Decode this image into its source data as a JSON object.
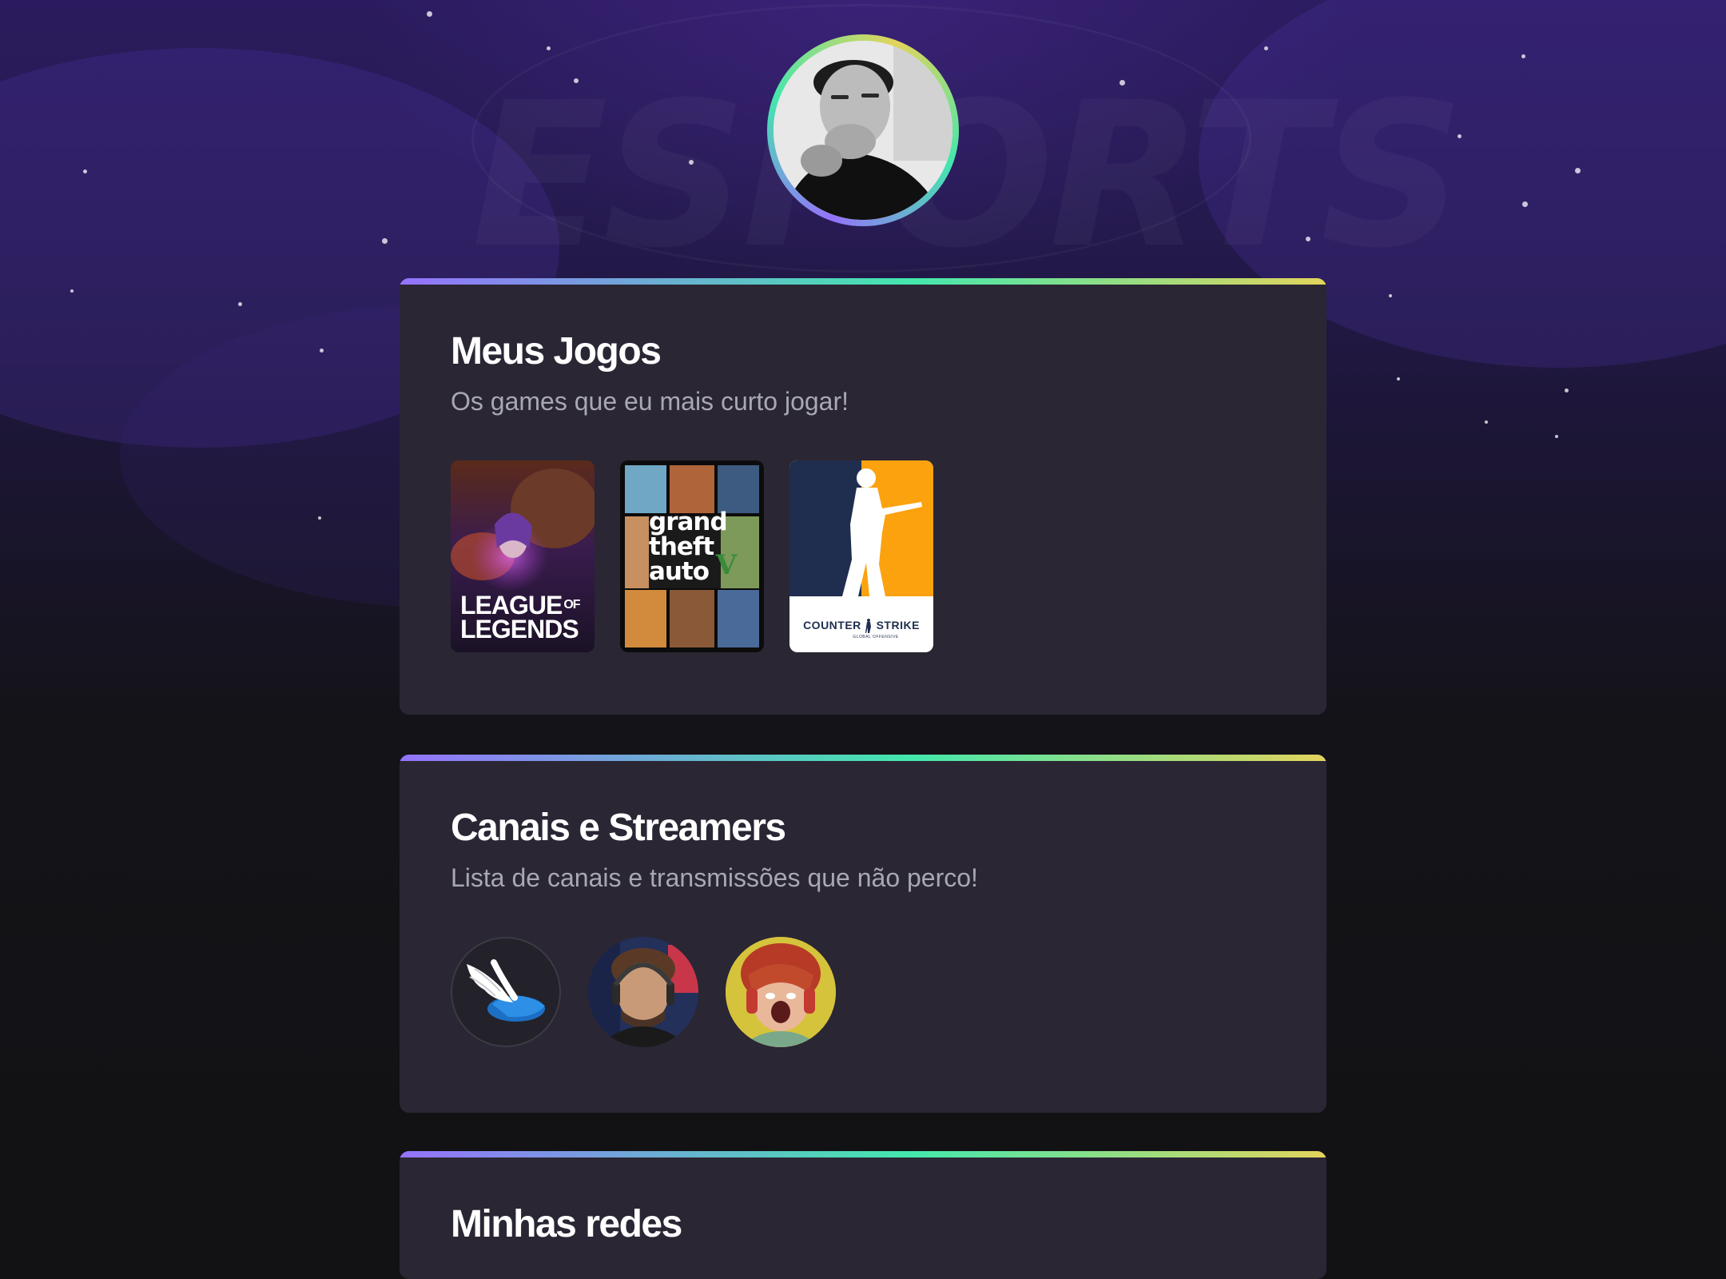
{
  "profile": {
    "avatar_icon": "profile-photo"
  },
  "background": {
    "watermark_text": "ESPORTS"
  },
  "games_section": {
    "title": "Meus Jogos",
    "subtitle": "Os games que eu mais curto jogar!",
    "games": [
      {
        "name": "League of Legends",
        "logo_line1": "LEAGUE",
        "logo_of": "OF",
        "logo_line2": "LEGENDS"
      },
      {
        "name": "Grand Theft Auto V",
        "logo_line1": "grand",
        "logo_line2": "theft",
        "logo_line3": "auto",
        "logo_numeral": "V"
      },
      {
        "name": "Counter-Strike: Global Offensive",
        "logo_left": "COUNTER",
        "logo_right": "STRIKE",
        "logo_sub": "GLOBAL OFFENSIVE"
      }
    ]
  },
  "streamers_section": {
    "title": "Canais e Streamers",
    "subtitle": "Lista de canais e transmissões que não perco!",
    "channels": [
      {
        "icon": "winged-shoe-logo"
      },
      {
        "icon": "streamer-with-headset-avatar"
      },
      {
        "icon": "red-hair-cartoon-avatar"
      }
    ]
  },
  "social_section": {
    "title": "Minhas redes"
  },
  "colors": {
    "page_bg": "#121214",
    "card_bg": "#2a2634",
    "accent_purple": "#9572fc",
    "accent_green": "#43e7ad",
    "accent_yellow": "#e2d45c",
    "title": "#ffffff",
    "subtitle": "#a8a8b3"
  }
}
